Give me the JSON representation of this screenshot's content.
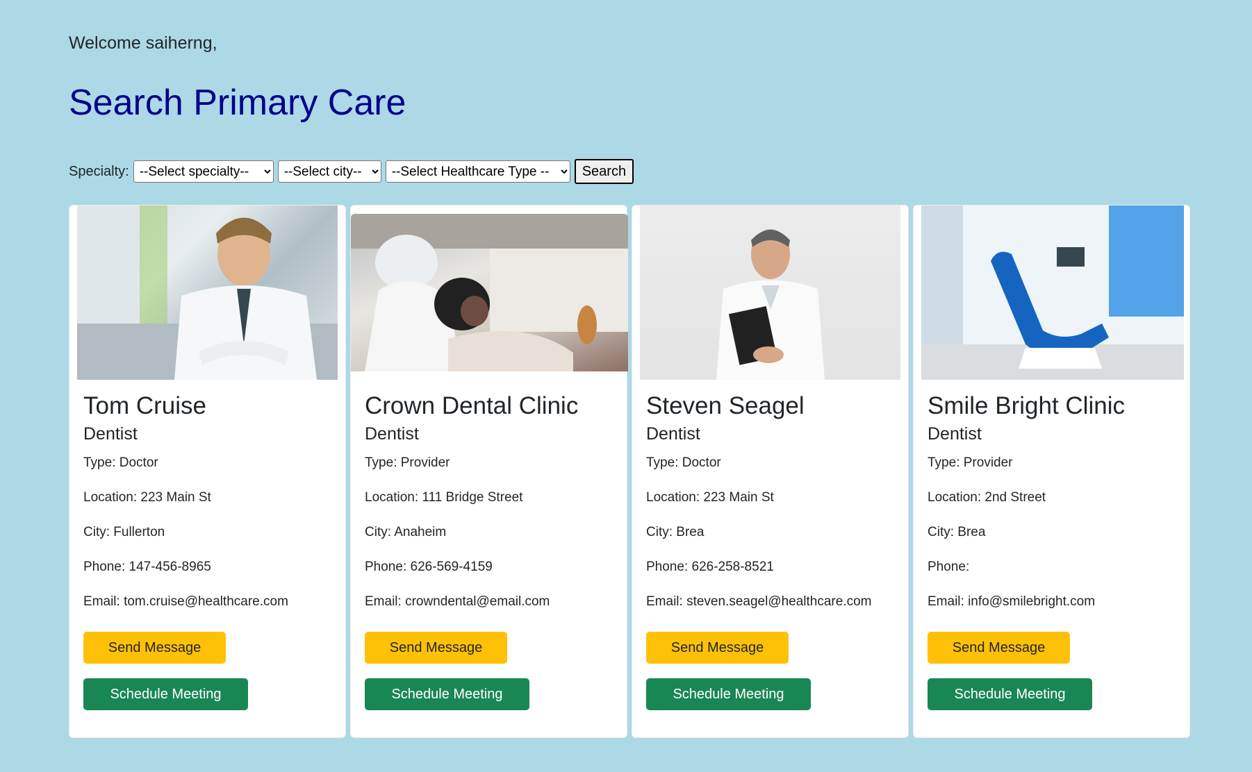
{
  "header": {
    "welcome_prefix": "Welcome",
    "username": "saiherng",
    "welcome_suffix": ",",
    "title": "Search Primary Care"
  },
  "filters": {
    "label": "Specialty:",
    "specialty": "--Select specialty--",
    "city": "--Select city--",
    "type": "--Select Healthcare Type --",
    "search_label": "Search"
  },
  "cards": [
    {
      "name": "Tom Cruise",
      "specialty": "Dentist",
      "type": "Type: Doctor",
      "location": "Location: 223 Main St",
      "city": "City: Fullerton",
      "phone": "Phone: 147-456-8965",
      "email": "Email: tom.cruise@healthcare.com",
      "send_label": "Send Message",
      "schedule_label": "Schedule Meeting",
      "photo": "doctor-portrait-photo"
    },
    {
      "name": "Crown Dental Clinic",
      "specialty": "Dentist",
      "type": "Type: Provider",
      "location": "Location: 111 Bridge Street",
      "city": "City: Anaheim",
      "phone": "Phone: 626-569-4159",
      "email": "Email: crowndental@email.com",
      "send_label": "Send Message",
      "schedule_label": "Schedule Meeting",
      "photo": "dental-exam-photo"
    },
    {
      "name": "Steven Seagel",
      "specialty": "Dentist",
      "type": "Type: Doctor",
      "location": "Location: 223 Main St",
      "city": "City: Brea",
      "phone": "Phone: 626-258-8521",
      "email": "Email: steven.seagel@healthcare.com",
      "send_label": "Send Message",
      "schedule_label": "Schedule Meeting",
      "photo": "doctor-clipboard-photo"
    },
    {
      "name": "Smile Bright Clinic",
      "specialty": "Dentist",
      "type": "Type: Provider",
      "location": "Location: 2nd Street",
      "city": "City: Brea",
      "phone": "Phone:",
      "email": "Email: info@smilebright.com",
      "send_label": "Send Message",
      "schedule_label": "Schedule Meeting",
      "photo": "dental-chair-photo"
    }
  ],
  "colors": {
    "background": "#add8e6",
    "title": "#00008b",
    "send_button": "#ffc107",
    "schedule_button": "#198754"
  }
}
